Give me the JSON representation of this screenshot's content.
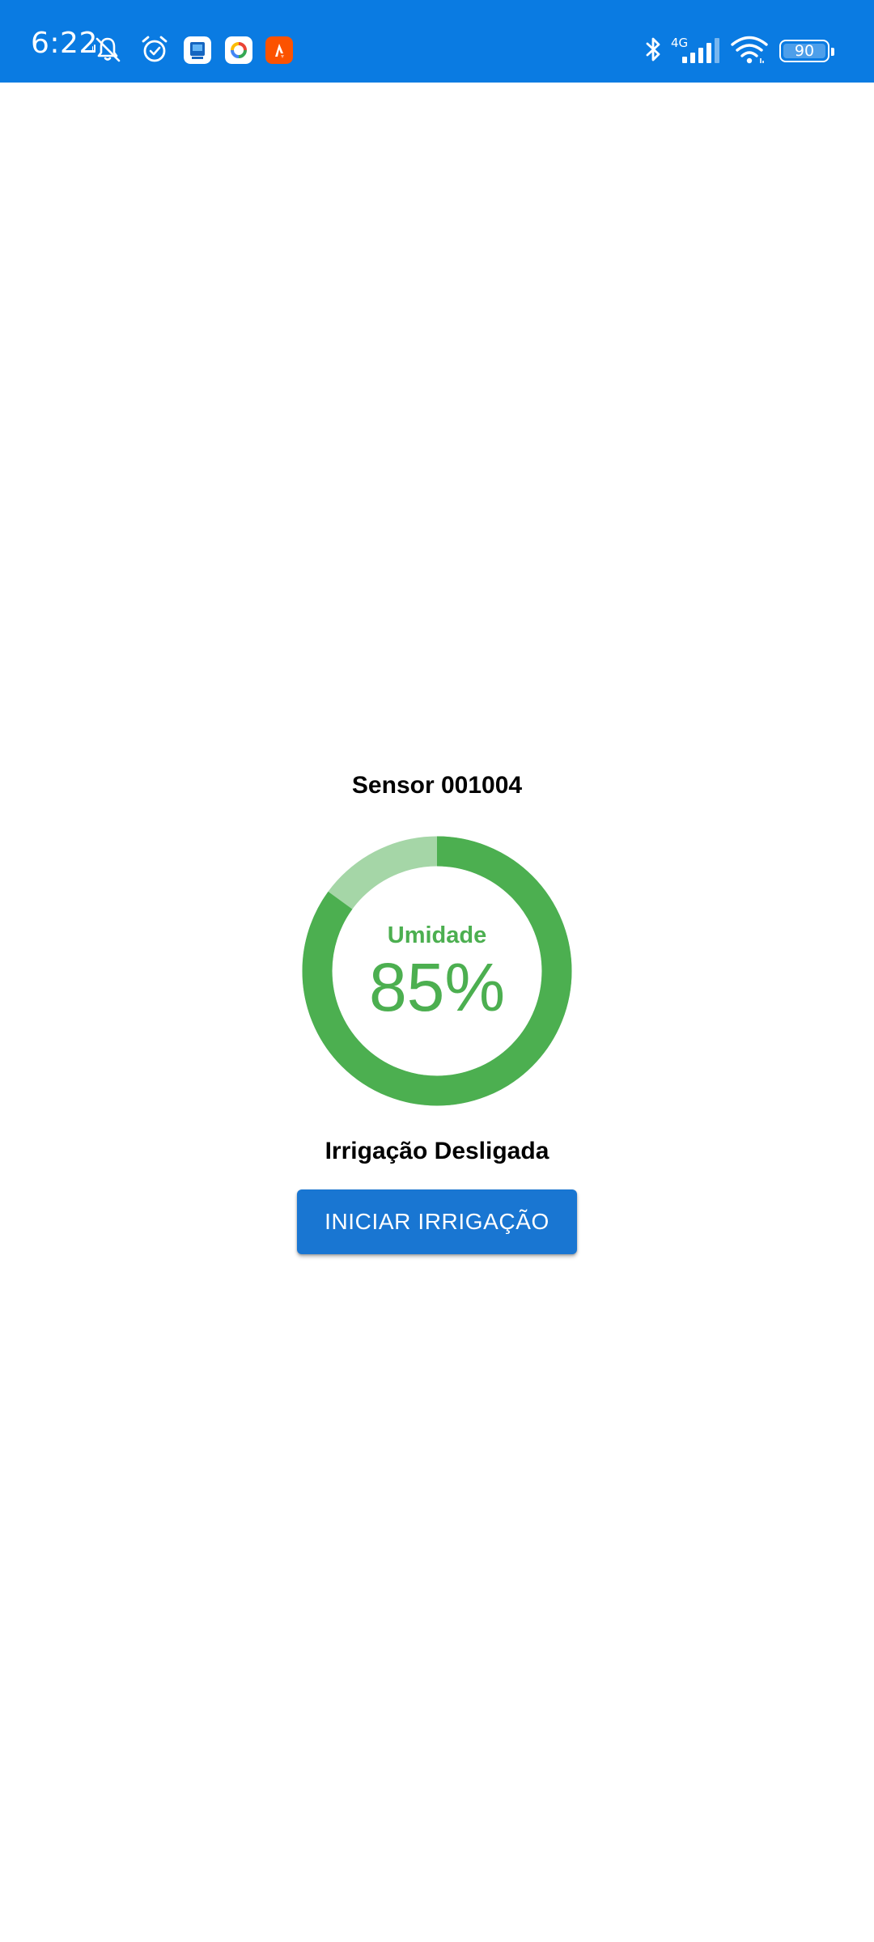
{
  "status_bar": {
    "time": "6:22",
    "network": "4G",
    "battery_level": "90",
    "background_color": "#0a7be2",
    "icons": [
      "mute-notification-icon",
      "alarm-clock-icon",
      "app-notification-icon",
      "app-notification-icon",
      "app-notification-icon",
      "bluetooth-icon",
      "signal-strength-icon",
      "wifi-icon",
      "battery-icon"
    ]
  },
  "sensor": {
    "title": "Sensor 001004"
  },
  "gauge": {
    "label": "Umidade",
    "value_text": "85%",
    "value": 85,
    "fill_color": "#4caf50",
    "track_color": "#a5d6a7"
  },
  "irrigation": {
    "status_text": "Irrigação Desligada",
    "button_label": "INICIAR IRRIGAÇÃO",
    "button_color": "#1976d2"
  }
}
